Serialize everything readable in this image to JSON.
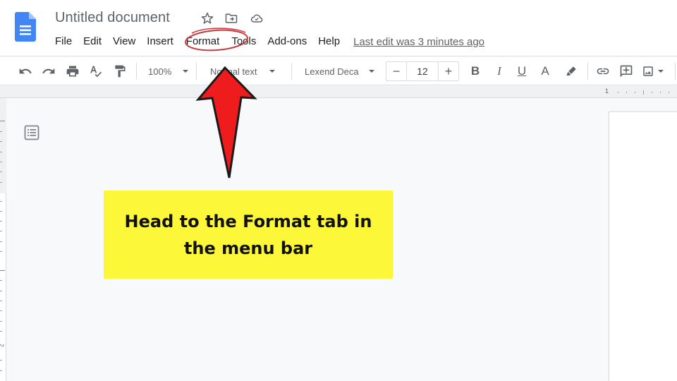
{
  "app": {
    "name": "Google Docs",
    "document_title": "Untitled document",
    "title_icons": [
      "star-icon",
      "move-to-folder-icon",
      "cloud-status-icon"
    ]
  },
  "menubar": {
    "items": [
      {
        "label": "File"
      },
      {
        "label": "Edit"
      },
      {
        "label": "View"
      },
      {
        "label": "Insert"
      },
      {
        "label": "Format",
        "highlighted": true
      },
      {
        "label": "Tools"
      },
      {
        "label": "Add-ons"
      },
      {
        "label": "Help"
      }
    ],
    "last_edit": "Last edit was 3 minutes ago"
  },
  "toolbar": {
    "undo": "undo-icon",
    "redo": "redo-icon",
    "print": "print-icon",
    "spellcheck": "spellcheck-icon",
    "paint_format": "paint-format-icon",
    "zoom": "100%",
    "style": "Normal text",
    "font": "Lexend Deca",
    "font_size": "12",
    "decrease": "−",
    "increase": "+",
    "bold": "B",
    "italic": "I",
    "underline": "U",
    "text_color": "A",
    "highlight": "highlight-icon",
    "link": "link-icon",
    "comment": "add-comment-icon",
    "image": "insert-image-icon"
  },
  "ruler": {
    "horizontal_label": "1",
    "vertical_label": "2"
  },
  "annotation": {
    "callout_line1": "Head to the Format tab in",
    "callout_line2": "the menu bar",
    "callout_color": "#fdf73a",
    "arrow_color": "#ee1c1c",
    "circle_color": "#c8373b",
    "target": "Format"
  }
}
